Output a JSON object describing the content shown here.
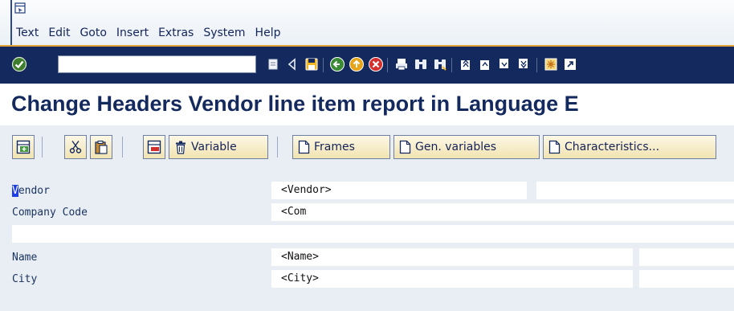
{
  "menubar": {
    "items": [
      "Text",
      "Edit",
      "Goto",
      "Insert",
      "Extras",
      "System",
      "Help"
    ]
  },
  "toolbar": {
    "command_field_value": ""
  },
  "page_title": "Change Headers Vendor line item report in Language E",
  "app_toolbar": {
    "variable_label": "Variable",
    "frames_label": "Frames",
    "gen_variables_label": "Gen. variables",
    "characteristics_label": "Characteristics..."
  },
  "form": {
    "vendor": {
      "label_first": "V",
      "label_rest": "endor",
      "value": "<Vendor>"
    },
    "company_code": {
      "label": "Company Code",
      "value": "<Com"
    },
    "name": {
      "label": "Name",
      "value": "<Name>"
    },
    "city": {
      "label": "City",
      "value": "<City>"
    }
  },
  "colors": {
    "toolbar_bg": "#142a5e",
    "title_text": "#142a5e",
    "menu_underline": "#e3a23a",
    "button_bg": "#f6edc8"
  }
}
